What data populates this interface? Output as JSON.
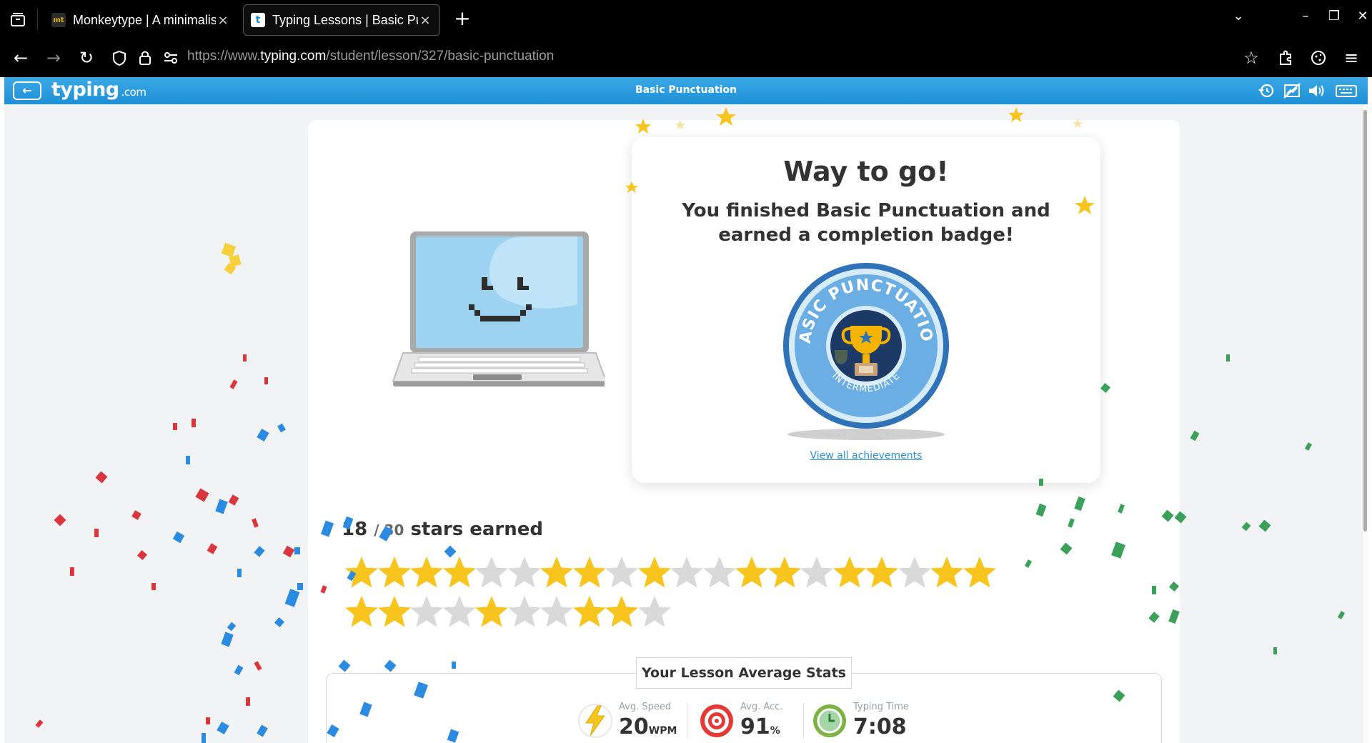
{
  "browser": {
    "tabs": [
      {
        "title": "Monkeytype | A minimalistic typing test",
        "favicon": "mt",
        "active": false
      },
      {
        "title": "Typing Lessons | Basic Punctuation",
        "favicon": "t",
        "active": true
      }
    ],
    "url_prefix": "https://www.",
    "url_host": "typing.com",
    "url_path": "/student/lesson/327/basic-punctuation"
  },
  "header": {
    "logo": "typing",
    "logo_suffix": ".com",
    "lesson_title": "Basic Punctuation",
    "icons": [
      "history-icon",
      "no-chart-icon",
      "volume-icon",
      "keyboard-icon"
    ]
  },
  "bubble": {
    "heading": "Way to go!",
    "message": "You finished Basic Punctuation and earned a completion badge!",
    "badge_title": "BASIC PUNCTUATION",
    "badge_level": "INTERMEDIATE",
    "view_all": "View all achievements"
  },
  "stars": {
    "earned": "18",
    "total": "30",
    "label": "stars earned",
    "row1": [
      1,
      1,
      1,
      1,
      0,
      0,
      1,
      1,
      0,
      1,
      0,
      0,
      1,
      1,
      0,
      1,
      1,
      0,
      1,
      1
    ],
    "row2": [
      1,
      1,
      0,
      0,
      1,
      0,
      0,
      1,
      1,
      0
    ],
    "colors": {
      "gold": "#f7c51e",
      "gray": "#d9d9d9"
    }
  },
  "stats": {
    "title": "Your Lesson Average Stats",
    "speed": {
      "label": "Avg. Speed",
      "value": "20",
      "unit": "WPM"
    },
    "accuracy": {
      "label": "Avg. Acc.",
      "value": "91",
      "unit": "%"
    },
    "time": {
      "label": "Typing Time",
      "value": "7:08"
    }
  },
  "colors": {
    "header_blue": "#1e90d6",
    "link": "#2b8fd8"
  }
}
